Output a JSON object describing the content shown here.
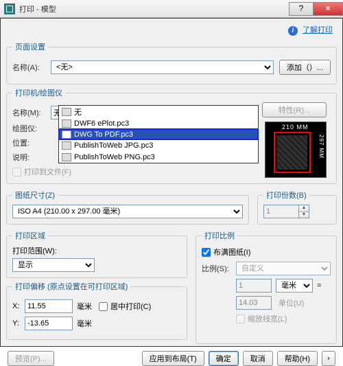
{
  "window": {
    "title": "打印 - 模型",
    "help": "?",
    "close": "×"
  },
  "toplink": {
    "label": "了解打印"
  },
  "pageSetup": {
    "legend": "页面设置",
    "nameLabel": "名称(A):",
    "nameValue": "<无>",
    "addBtn": "添加（）..."
  },
  "printer": {
    "legend": "打印机/绘图仪",
    "nameLabel": "名称(M):",
    "nameValue": "无",
    "propsBtn": "特性(R)...",
    "plotterLabel": "绘图仪:",
    "whereLabel": "位置:",
    "descLabel": "说明:",
    "toFile": "打印到文件(F)",
    "options": [
      "无",
      "DWF6 ePlot.pc3",
      "DWG To PDF.pc3",
      "PublishToWeb JPG.pc3",
      "PublishToWeb PNG.pc3"
    ],
    "preview": {
      "width": "210 MM",
      "height": "297 MM"
    }
  },
  "paperSize": {
    "legend": "图纸尺寸(Z)",
    "value": "ISO A4 (210.00 x 297.00 毫米)"
  },
  "copies": {
    "legend": "打印份数(B)",
    "value": "1"
  },
  "area": {
    "legend": "打印区域",
    "rangeLabel": "打印范围(W):",
    "rangeValue": "显示"
  },
  "scale": {
    "legend": "打印比例",
    "fit": "布满图纸(I)",
    "ratioLabel": "比例(S):",
    "ratioValue": "自定义",
    "val1": "1",
    "unit": "毫米",
    "eq": "=",
    "val2": "14.03",
    "unitsLabel": "单位(U)",
    "lineweights": "缩放线宽(L)"
  },
  "offset": {
    "legend": "打印偏移 (原点设置在可打印区域)",
    "xLabel": "X:",
    "xValue": "11.55",
    "xUnit": "毫米",
    "center": "居中打印(C)",
    "yLabel": "Y:",
    "yValue": "-13.65",
    "yUnit": "毫米"
  },
  "footer": {
    "preview": "预览(P)...",
    "applyLayout": "应用到布局(T)",
    "ok": "确定",
    "cancel": "取消",
    "help": "帮助(H)",
    "expand": "›"
  }
}
